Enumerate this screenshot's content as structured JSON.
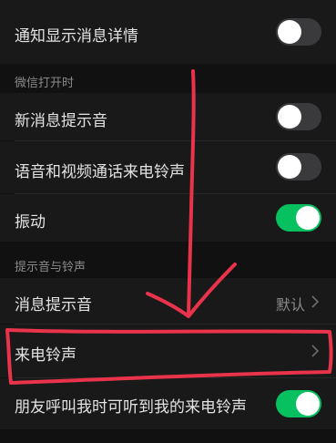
{
  "rows": {
    "notify_details": {
      "label": "通知显示消息详情",
      "on": false
    },
    "new_msg_sound": {
      "label": "新消息提示音",
      "on": false
    },
    "voice_video_ringtone": {
      "label": "语音和视频通话来电铃声",
      "on": false
    },
    "vibrate": {
      "label": "振动",
      "on": true
    },
    "message_sound": {
      "label": "消息提示音",
      "value": "默认"
    },
    "ringtone": {
      "label": "来电铃声"
    },
    "friend_hear_ringtone": {
      "label": "朋友呼叫我时可听到我的来电铃声",
      "on": true
    }
  },
  "sections": {
    "wechat_open": "微信打开时",
    "sound_ringtone": "提示音与铃声"
  },
  "colors": {
    "toggle_on": "#07c160",
    "toggle_off": "#3a3a3c",
    "annotation": "#e8334a"
  }
}
